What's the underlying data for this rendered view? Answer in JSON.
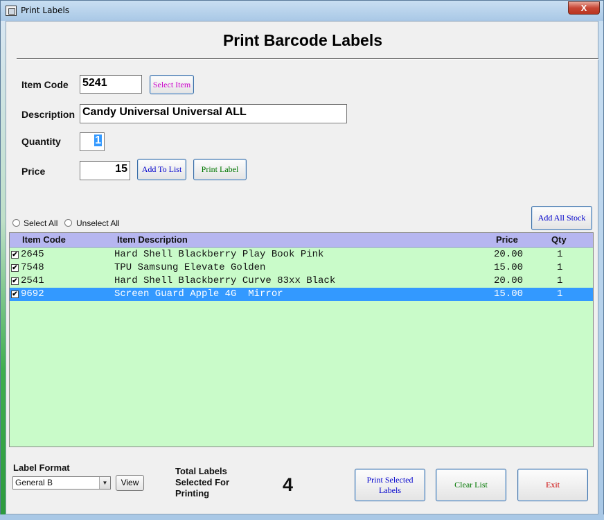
{
  "window": {
    "title": "Print Labels",
    "close_glyph": "X"
  },
  "heading": "Print Barcode Labels",
  "form": {
    "item_code_label": "Item Code",
    "item_code_value": "5241",
    "select_item_label": "Select Item",
    "description_label": "Description",
    "description_value": "Candy Universal Universal ALL",
    "quantity_label": "Quantity",
    "quantity_value": "1",
    "price_label": "Price",
    "price_value": "15",
    "add_to_list_label": "Add To List",
    "print_label_label": "Print Label"
  },
  "selection": {
    "select_all_label": "Select All",
    "unselect_all_label": "Unselect All",
    "add_all_stock_label": "Add All Stock"
  },
  "grid": {
    "columns": [
      "Item Code",
      "Item Description",
      "Price",
      "Qty"
    ],
    "rows": [
      {
        "checked": true,
        "code": "2645",
        "description": "Hard Shell Blackberry Play Book Pink",
        "price": "20.00",
        "qty": "1",
        "selected": false
      },
      {
        "checked": true,
        "code": "7548",
        "description": "TPU Samsung Elevate Golden",
        "price": "15.00",
        "qty": "1",
        "selected": false
      },
      {
        "checked": true,
        "code": "2541",
        "description": "Hard Shell Blackberry Curve 83xx Black",
        "price": "20.00",
        "qty": "1",
        "selected": false
      },
      {
        "checked": true,
        "code": "9692",
        "description": "Screen Guard Apple 4G  Mirror",
        "price": "15.00",
        "qty": "1",
        "selected": true
      }
    ],
    "check_glyph": "✔"
  },
  "footer": {
    "label_format_label": "Label Format",
    "label_format_value": "General B",
    "view_label": "View",
    "total_line1": "Total Labels",
    "total_line2": "Selected For",
    "total_line3": "Printing",
    "total_value": "4",
    "print_selected_line1": "Print Selected",
    "print_selected_line2": "Labels",
    "clear_list_label": "Clear List",
    "exit_label": "Exit"
  },
  "colors": {
    "grid_background": "#c9fbc9",
    "grid_header": "#b6b6f0",
    "selected_row": "#3399ff",
    "select_item_text": "#cc00cc",
    "add_to_list_text": "#0000cc",
    "print_label_text": "#007700",
    "exit_text": "#cc0000"
  },
  "icons": {
    "dropdown": "▼"
  }
}
